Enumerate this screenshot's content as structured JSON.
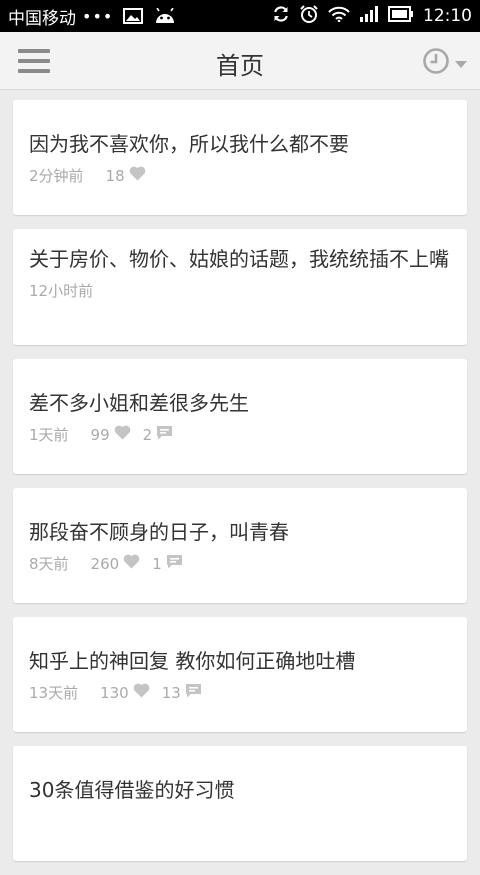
{
  "status_bar": {
    "carrier": "中国移动",
    "dots": "•••",
    "time": "12:10"
  },
  "app_bar": {
    "title": "首页"
  },
  "posts": [
    {
      "title": "因为我不喜欢你，所以我什么都不要",
      "time": "2分钟前",
      "likes": "18",
      "comments": null
    },
    {
      "title": "关于房价、物价、姑娘的话题，我统统插不上嘴",
      "time": "12小时前",
      "likes": null,
      "comments": null
    },
    {
      "title": "差不多小姐和差很多先生",
      "time": "1天前",
      "likes": "99",
      "comments": "2"
    },
    {
      "title": "那段奋不顾身的日子，叫青春",
      "time": "8天前",
      "likes": "260",
      "comments": "1"
    },
    {
      "title": "知乎上的神回复 教你如何正确地吐槽",
      "time": "13天前",
      "likes": "130",
      "comments": "13"
    },
    {
      "title": "30条值得借鉴的好习惯",
      "time": null,
      "likes": null,
      "comments": null
    }
  ],
  "colors": {
    "background": "#ebebeb",
    "card": "#ffffff",
    "title_text": "#333333",
    "meta_text": "#aaaaaa",
    "icon_gray": "#c4c4c4"
  }
}
